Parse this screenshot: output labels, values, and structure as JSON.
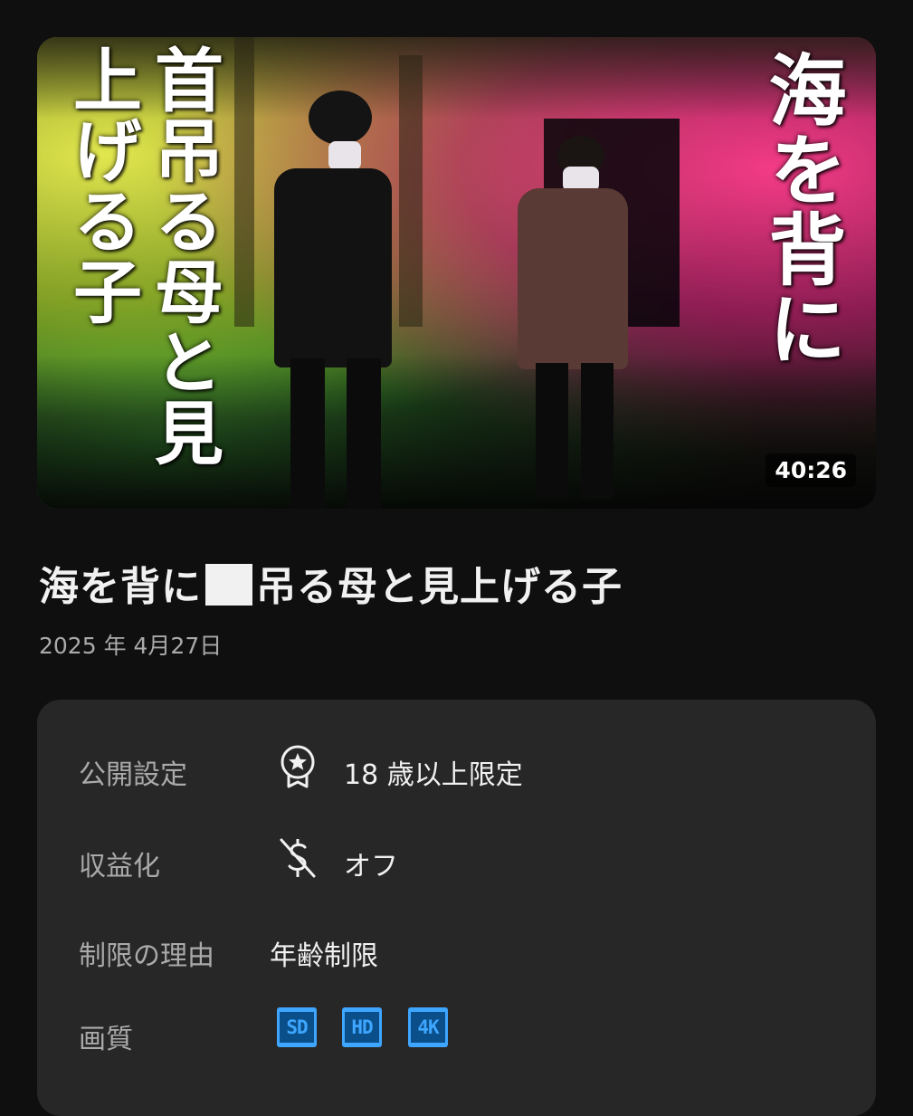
{
  "video": {
    "thumbnail": {
      "text_left": "首吊る母と見上げる子",
      "text_right": "海を背に",
      "duration": "40:26"
    },
    "title_before": "海を背に",
    "title_after": "吊る母と見上げる子",
    "date": "2025 年 4月27日"
  },
  "details": {
    "visibility": {
      "label": "公開設定",
      "value": "18 歳以上限定",
      "icon": "award-star-icon"
    },
    "monetization": {
      "label": "収益化",
      "value": "オフ",
      "icon": "dollar-off-icon"
    },
    "restriction": {
      "label": "制限の理由",
      "value": "年齢制限"
    },
    "quality": {
      "label": "画質",
      "badges": [
        "SD",
        "HD",
        "4K"
      ]
    }
  },
  "colors": {
    "background": "#0f0f0f",
    "card": "#272727",
    "accent": "#3ea6ff"
  }
}
